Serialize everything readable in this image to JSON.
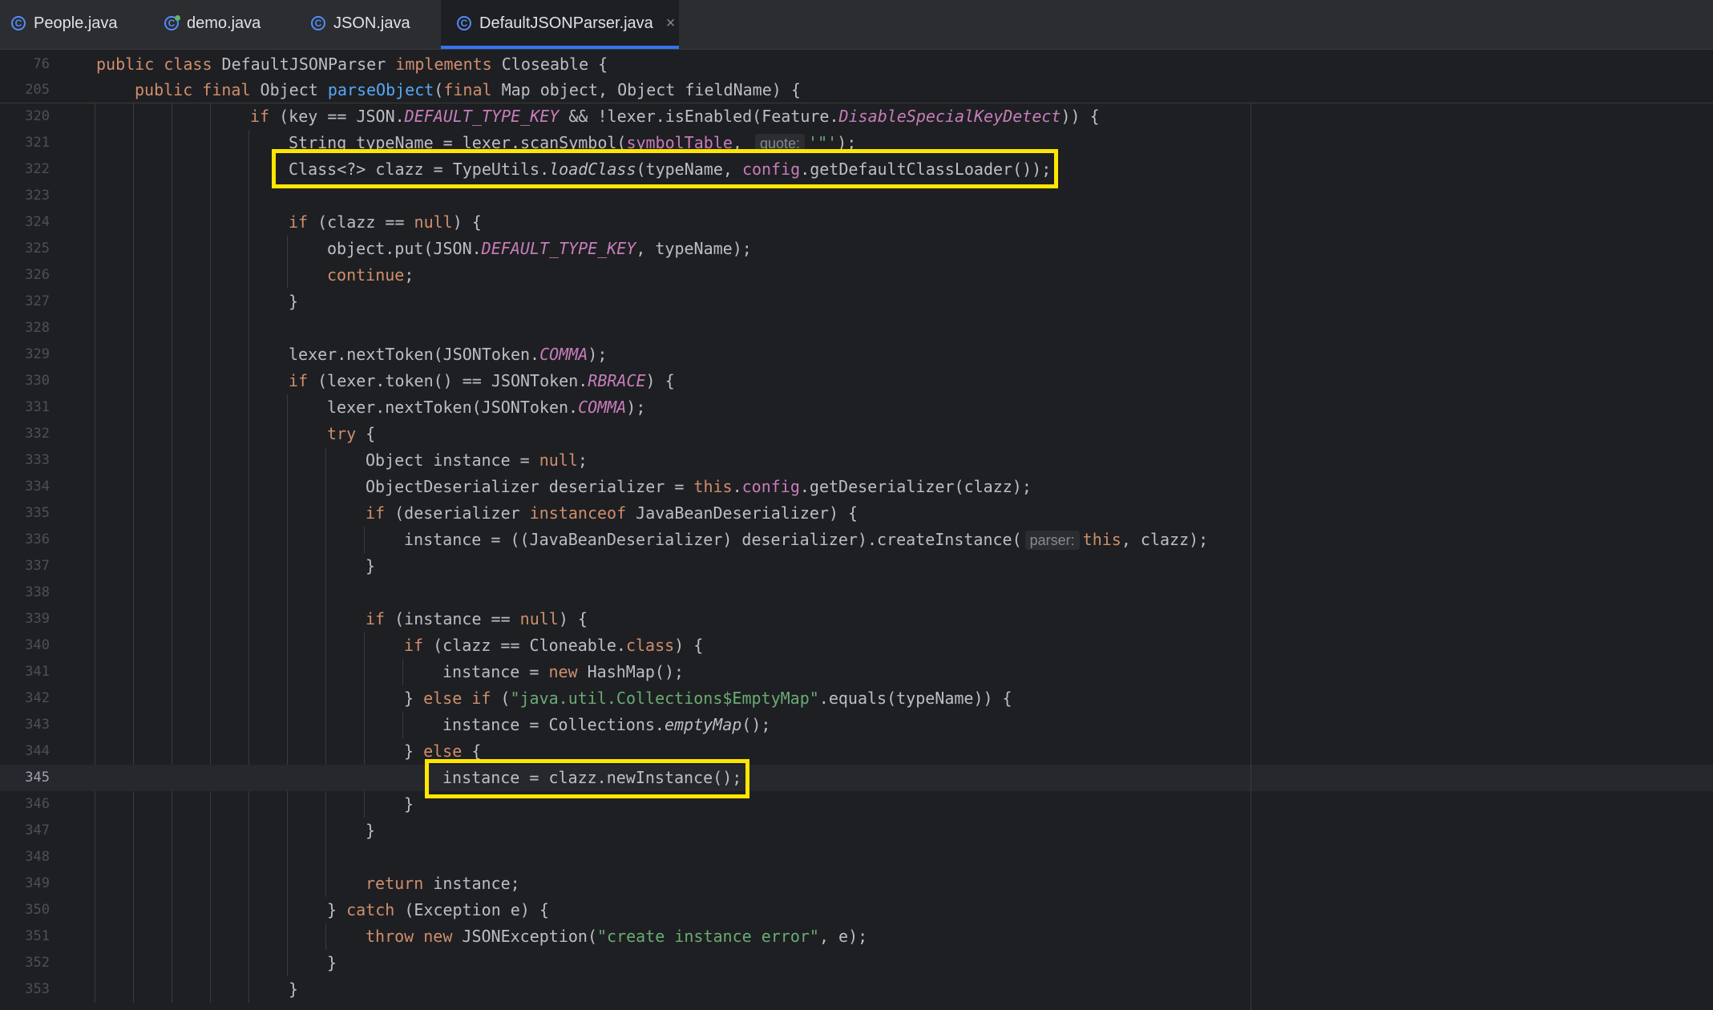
{
  "tabs": [
    {
      "label": "People.java",
      "active": false
    },
    {
      "label": "demo.java",
      "active": false
    },
    {
      "label": "JSON.java",
      "active": false
    },
    {
      "label": "DefaultJSONParser.java",
      "active": true
    }
  ],
  "tab_close_glyph": "×",
  "icons": {
    "class_icon": "class-icon",
    "runnable_class_icon": "runnable-class-icon",
    "close_icon": "close-icon"
  },
  "sticky_lines": [
    {
      "num": "76",
      "tokens": [
        [
          "kw",
          "public class "
        ],
        [
          "",
          "DefaultJSONParser "
        ],
        [
          "kw",
          "implements "
        ],
        [
          "",
          "Closeable {"
        ]
      ]
    },
    {
      "num": "205",
      "tokens": [
        [
          "kw",
          "public final "
        ],
        [
          "",
          "Object "
        ],
        [
          "fn",
          "parseObject"
        ],
        [
          "",
          "("
        ],
        [
          "kw",
          "final "
        ],
        [
          "",
          "Map object, Object fieldName) {"
        ]
      ]
    }
  ],
  "lines": [
    {
      "num": "320",
      "indent": 4,
      "tokens": [
        [
          "kw",
          "if "
        ],
        [
          "",
          "(key == JSON."
        ],
        [
          "st",
          "DEFAULT_TYPE_KEY"
        ],
        [
          "",
          " && !lexer.isEnabled(Feature."
        ],
        [
          "st",
          "DisableSpecialKeyDetect"
        ],
        [
          "",
          "))"
        ],
        [
          "",
          " {"
        ]
      ]
    },
    {
      "num": "321",
      "indent": 5,
      "tokens": [
        [
          "",
          "String typeName = lexer.scanSymbol("
        ],
        [
          "fld",
          "symbolTable"
        ],
        [
          "",
          ", "
        ],
        [
          "hint",
          "quote:"
        ],
        [
          "str",
          "'\"'"
        ],
        [
          "",
          ");"
        ]
      ]
    },
    {
      "num": "322",
      "indent": 5,
      "tokens": [
        [
          "",
          "Class<?> clazz = TypeUtils."
        ],
        [
          "it",
          "loadClass"
        ],
        [
          "",
          "(typeName, "
        ],
        [
          "fld",
          "config"
        ],
        [
          "",
          ".getDefaultClassLoader());"
        ]
      ]
    },
    {
      "num": "323",
      "indent": 5,
      "tokens": []
    },
    {
      "num": "324",
      "indent": 5,
      "tokens": [
        [
          "kw",
          "if "
        ],
        [
          "",
          "(clazz == "
        ],
        [
          "kw",
          "null"
        ],
        [
          "",
          ") {"
        ]
      ]
    },
    {
      "num": "325",
      "indent": 6,
      "tokens": [
        [
          "",
          "object.put(JSON."
        ],
        [
          "st",
          "DEFAULT_TYPE_KEY"
        ],
        [
          "",
          ", typeName);"
        ]
      ]
    },
    {
      "num": "326",
      "indent": 6,
      "tokens": [
        [
          "kw",
          "continue"
        ],
        [
          "",
          ";"
        ]
      ]
    },
    {
      "num": "327",
      "indent": 5,
      "tokens": [
        [
          "",
          "}"
        ]
      ]
    },
    {
      "num": "328",
      "indent": 5,
      "tokens": []
    },
    {
      "num": "329",
      "indent": 5,
      "tokens": [
        [
          "",
          "lexer.nextToken(JSONToken."
        ],
        [
          "st",
          "COMMA"
        ],
        [
          "",
          ");"
        ]
      ]
    },
    {
      "num": "330",
      "indent": 5,
      "tokens": [
        [
          "kw",
          "if "
        ],
        [
          "",
          "(lexer.token() == JSONToken."
        ],
        [
          "st",
          "RBRACE"
        ],
        [
          "",
          ") {"
        ]
      ]
    },
    {
      "num": "331",
      "indent": 6,
      "tokens": [
        [
          "",
          "lexer.nextToken(JSONToken."
        ],
        [
          "st",
          "COMMA"
        ],
        [
          "",
          ");"
        ]
      ]
    },
    {
      "num": "332",
      "indent": 6,
      "tokens": [
        [
          "kw",
          "try "
        ],
        [
          "",
          "{"
        ]
      ]
    },
    {
      "num": "333",
      "indent": 7,
      "tokens": [
        [
          "",
          "Object instance = "
        ],
        [
          "kw",
          "null"
        ],
        [
          "",
          ";"
        ]
      ]
    },
    {
      "num": "334",
      "indent": 7,
      "tokens": [
        [
          "",
          "ObjectDeserializer deserializer = "
        ],
        [
          "kw",
          "this"
        ],
        [
          "",
          "."
        ],
        [
          "fld",
          "config"
        ],
        [
          "",
          ".getDeserializer(clazz);"
        ]
      ]
    },
    {
      "num": "335",
      "indent": 7,
      "tokens": [
        [
          "kw",
          "if "
        ],
        [
          "",
          "(deserializer "
        ],
        [
          "kw",
          "instanceof "
        ],
        [
          "",
          "JavaBeanDeserializer) {"
        ]
      ]
    },
    {
      "num": "336",
      "indent": 8,
      "tokens": [
        [
          "",
          "instance = ((JavaBeanDeserializer) deserializer).createInstance("
        ],
        [
          "hint",
          "parser:"
        ],
        [
          "kw",
          "this"
        ],
        [
          "",
          ", clazz);"
        ]
      ]
    },
    {
      "num": "337",
      "indent": 7,
      "tokens": [
        [
          "",
          "}"
        ]
      ]
    },
    {
      "num": "338",
      "indent": 7,
      "tokens": []
    },
    {
      "num": "339",
      "indent": 7,
      "tokens": [
        [
          "kw",
          "if "
        ],
        [
          "",
          "(instance == "
        ],
        [
          "kw",
          "null"
        ],
        [
          "",
          ") {"
        ]
      ]
    },
    {
      "num": "340",
      "indent": 8,
      "tokens": [
        [
          "kw",
          "if "
        ],
        [
          "",
          "(clazz == Cloneable."
        ],
        [
          "kw",
          "class"
        ],
        [
          "",
          ") {"
        ]
      ]
    },
    {
      "num": "341",
      "indent": 9,
      "tokens": [
        [
          "",
          "instance = "
        ],
        [
          "kw",
          "new "
        ],
        [
          "",
          "HashMap();"
        ]
      ]
    },
    {
      "num": "342",
      "indent": 8,
      "tokens": [
        [
          "",
          "} "
        ],
        [
          "kw",
          "else if "
        ],
        [
          "",
          "("
        ],
        [
          "str",
          "\"java.util.Collections$EmptyMap\""
        ],
        [
          "",
          ".equals(typeName)) {"
        ]
      ]
    },
    {
      "num": "343",
      "indent": 9,
      "tokens": [
        [
          "",
          "instance = Collections."
        ],
        [
          "it",
          "emptyMap"
        ],
        [
          "",
          "();"
        ]
      ]
    },
    {
      "num": "344",
      "indent": 8,
      "tokens": [
        [
          "",
          "} "
        ],
        [
          "kw",
          "else "
        ],
        [
          "",
          "{"
        ]
      ]
    },
    {
      "num": "345",
      "indent": 9,
      "current": true,
      "tokens": [
        [
          "",
          "instance = clazz.newInstance();"
        ]
      ]
    },
    {
      "num": "346",
      "indent": 8,
      "tokens": [
        [
          "",
          "}"
        ]
      ]
    },
    {
      "num": "347",
      "indent": 7,
      "tokens": [
        [
          "",
          "}"
        ]
      ]
    },
    {
      "num": "348",
      "indent": 7,
      "tokens": []
    },
    {
      "num": "349",
      "indent": 7,
      "tokens": [
        [
          "kw",
          "return "
        ],
        [
          "",
          "instance;"
        ]
      ]
    },
    {
      "num": "350",
      "indent": 6,
      "tokens": [
        [
          "",
          "} "
        ],
        [
          "kw",
          "catch "
        ],
        [
          "",
          "(Exception e) {"
        ]
      ]
    },
    {
      "num": "351",
      "indent": 7,
      "tokens": [
        [
          "kw",
          "throw new "
        ],
        [
          "",
          "JSONException("
        ],
        [
          "str",
          "\"create instance error\""
        ],
        [
          "",
          ", e);"
        ]
      ]
    },
    {
      "num": "352",
      "indent": 6,
      "tokens": [
        [
          "",
          "}"
        ]
      ]
    },
    {
      "num": "353",
      "indent": 5,
      "tokens": [
        [
          "",
          "}"
        ]
      ]
    }
  ],
  "highlight_color": "#ffe600"
}
